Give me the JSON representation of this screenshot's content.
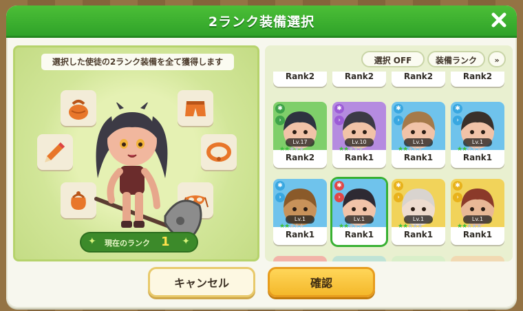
{
  "dialog": {
    "title": "2ランク装備選択"
  },
  "left_panel": {
    "description": "選択した使徒の2ランク装備を全て獲得します",
    "current_rank_label": "現在のランク",
    "current_rank_value": "1",
    "equipment_slots": [
      "bag-icon",
      "shorts-icon",
      "pencil-icon",
      "bracelet-icon",
      "pouch-icon",
      "mask-icon"
    ]
  },
  "filters": {
    "select_off": "選択 OFF",
    "sort": "装備ランク"
  },
  "cards": [
    {
      "rank": "Rank2",
      "partial": true
    },
    {
      "rank": "Rank2",
      "partial": true
    },
    {
      "rank": "Rank2",
      "partial": true
    },
    {
      "rank": "Rank2",
      "partial": true
    },
    {
      "rank": "Rank2",
      "level": "Lv.17",
      "frame": "#7fcf6a",
      "element_color": "#3fa34a"
    },
    {
      "rank": "Rank1",
      "level": "Lv.10",
      "frame": "#b58be0",
      "element_color": "#9c5bd6"
    },
    {
      "rank": "Rank1",
      "level": "Lv.1",
      "frame": "#6fc3ec",
      "element_color": "#39a7e0"
    },
    {
      "rank": "Rank1",
      "level": "Lv.1",
      "frame": "#6fc3ec",
      "element_color": "#39a7e0"
    },
    {
      "rank": "Rank1",
      "level": "Lv.1",
      "frame": "#6fc3ec",
      "element_color": "#39a7e0"
    },
    {
      "rank": "Rank1",
      "level": "Lv.1",
      "frame": "#6fc3ec",
      "element_color": "#e04848",
      "selected": true
    },
    {
      "rank": "Rank1",
      "level": "Lv.1",
      "frame": "#f1d35a",
      "element_color": "#e8b21c"
    },
    {
      "rank": "Rank1",
      "level": "Lv.1",
      "frame": "#f1d35a",
      "element_color": "#e8b21c"
    }
  ],
  "buttons": {
    "cancel": "キャンセル",
    "confirm": "確認"
  },
  "colors": {
    "title_green": "#34a82c",
    "confirm_yellow": "#f4b82b",
    "selected_outline": "#37b032"
  }
}
